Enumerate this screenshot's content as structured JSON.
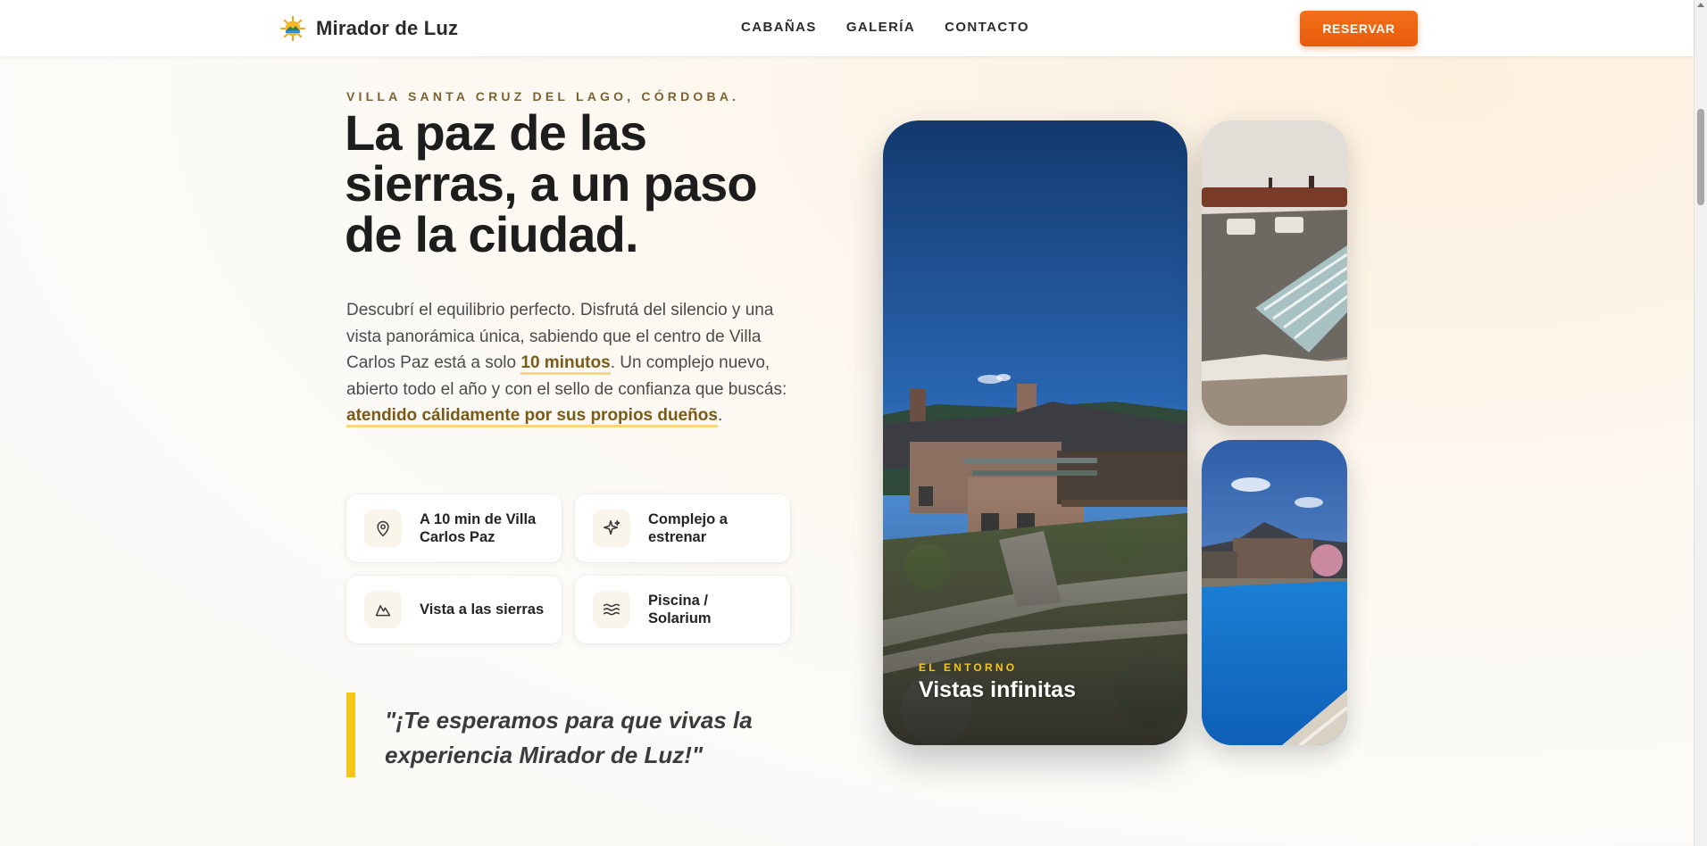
{
  "header": {
    "brand_name": "Mirador de Luz",
    "logo_icon": "sun-logo-icon",
    "nav": [
      {
        "label": "CABAÑAS"
      },
      {
        "label": "GALERÍA"
      },
      {
        "label": "CONTACTO"
      }
    ],
    "reserve_label": "RESERVAR"
  },
  "hero": {
    "eyebrow": "VILLA SANTA CRUZ DEL LAGO, CÓRDOBA.",
    "title": "La paz de las sierras, a un paso de la ciudad.",
    "description": {
      "part1": "Descubrí el equilibrio perfecto. Disfrutá del silencio y una vista panorámica única, sabiendo que el centro de Villa Carlos Paz está a solo ",
      "highlight1": "10 minutos",
      "part2": ". Un complejo nuevo, abierto todo el año y con el sello de confianza que buscás: ",
      "highlight2": "atendido cálidamente por sus propios dueños",
      "part3": "."
    },
    "features": [
      {
        "icon": "map-pin-icon",
        "label": "A 10 min de Villa Carlos Paz"
      },
      {
        "icon": "sparkle-icon",
        "label": "Complejo a estrenar"
      },
      {
        "icon": "mountain-icon",
        "label": "Vista a las sierras"
      },
      {
        "icon": "waves-icon",
        "label": "Piscina / Solarium"
      }
    ],
    "quote": "\"¡Te esperamos para que vivas la experiencia Mirador de Luz!\""
  },
  "gallery": {
    "main": {
      "eyebrow": "EL ENTORNO",
      "title": "Vistas infinitas"
    }
  },
  "colors": {
    "accent_orange": "#ee650f",
    "accent_yellow": "#f5c518",
    "text_dark": "#1d1d1d"
  }
}
